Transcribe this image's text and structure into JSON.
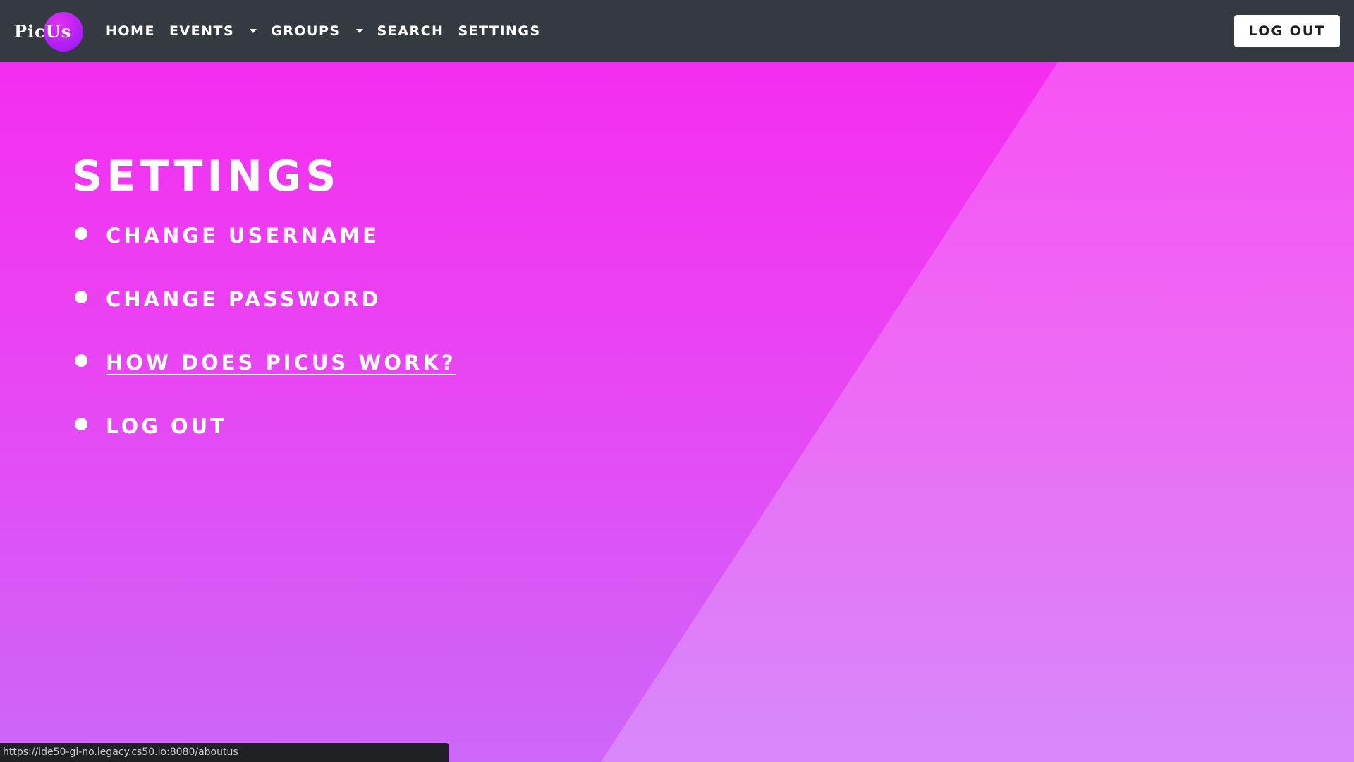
{
  "app": {
    "brand": "PicUs"
  },
  "nav": {
    "items": [
      {
        "label": "HOME"
      },
      {
        "label": "EVENTS"
      },
      {
        "label": "GROUPS"
      },
      {
        "label": "SEARCH"
      },
      {
        "label": "SETTINGS"
      }
    ],
    "logout_label": "LOG OUT"
  },
  "main": {
    "title": "SETTINGS",
    "items": [
      {
        "label": "CHANGE USERNAME"
      },
      {
        "label": "CHANGE PASSWORD"
      },
      {
        "label": "HOW DOES PICUS WORK?"
      },
      {
        "label": "LOG OUT"
      }
    ]
  },
  "status_bar": {
    "url": "https://ide50-gi-no.legacy.cs50.io:8080/aboutus"
  },
  "colors": {
    "navbar": "#343a40",
    "background_top": "#f52df0",
    "background_bottom": "#cd67f9",
    "logo_circle": "#b020f5"
  }
}
